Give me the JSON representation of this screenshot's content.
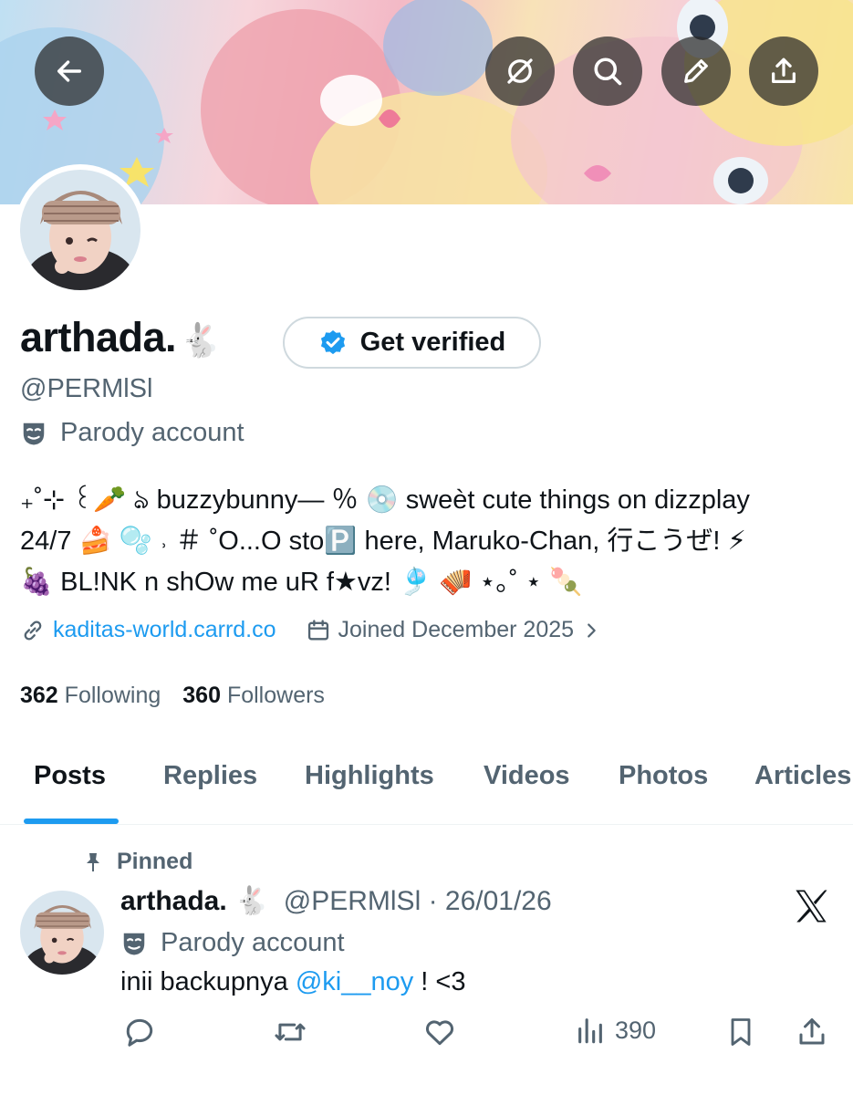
{
  "header": {
    "back_icon": "arrow-left-icon",
    "actions": [
      "grok-icon",
      "search-icon",
      "edit-icon",
      "share-icon"
    ]
  },
  "profile": {
    "display_name": "arthada.",
    "name_emoji": "🐇",
    "verify_label": "Get verified",
    "handle": "@PERMlSl",
    "parody_label": "Parody account",
    "bio_line1": "₊˚⊹ ꒰🥕 ঌ buzzybunny— ％ 💿 sweèt cute things on dizzplay",
    "bio_line2": "24/7 🍰 🫧 ˒ ＃ ˚O...O sto🅿️ here, Maruko-Chan, 行こうぜ! ⚡",
    "bio_line3": "🍇 BL!NK n shOw me uR f★vz! 🎐 🪗 ⋆｡˚ ⋆ 🍡",
    "link": "kaditas-world.carrd.co",
    "joined": "Joined December 2025",
    "following_count": "362",
    "following_label": "Following",
    "followers_count": "360",
    "followers_label": "Followers"
  },
  "tabs": [
    "Posts",
    "Replies",
    "Highlights",
    "Videos",
    "Photos",
    "Articles"
  ],
  "post": {
    "pinned_label": "Pinned",
    "name": "arthada.",
    "name_emoji": "🐇",
    "meta": "@PERMlSl · 26/01/26",
    "parody_label": "Parody account",
    "text_before": "inii backupnya ",
    "mention": "@ki__noy",
    "text_after": " ! <3",
    "views": "390"
  },
  "colors": {
    "accent": "#1d9bf0",
    "secondary_text": "#536471",
    "primary_text": "#0f1419"
  }
}
